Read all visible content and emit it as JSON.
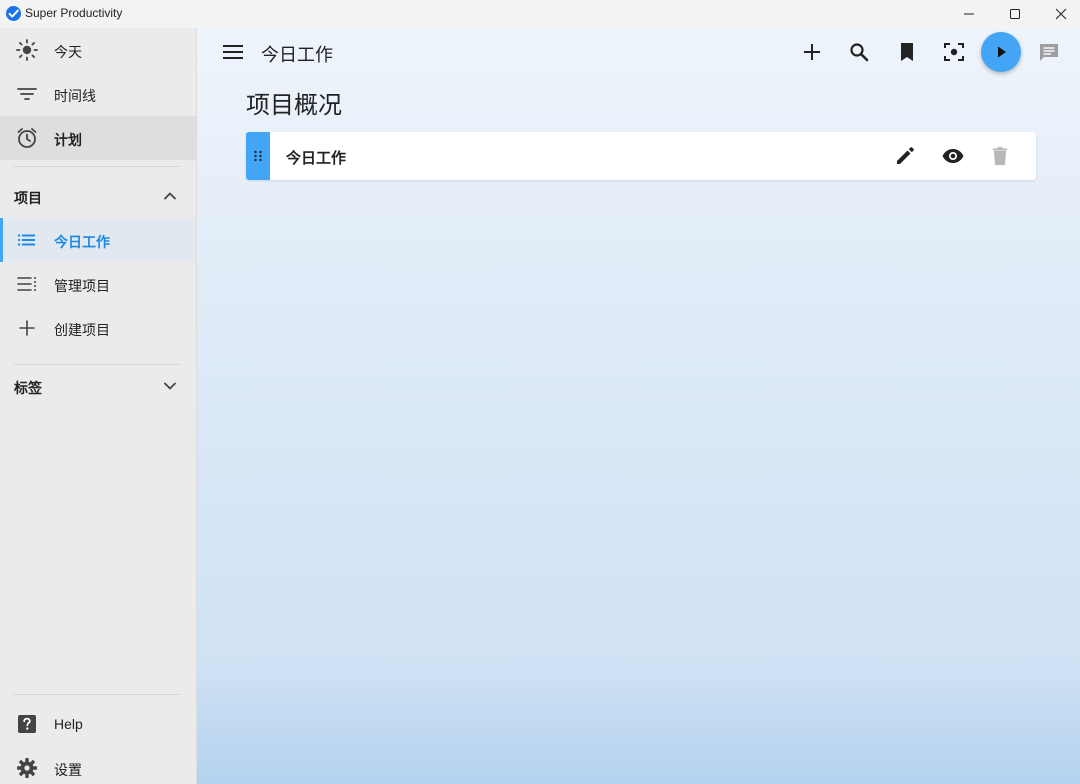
{
  "window": {
    "title": "Super Productivity"
  },
  "sidebar": {
    "nav": [
      {
        "label": "今天",
        "icon": "sun-icon"
      },
      {
        "label": "时间线",
        "icon": "filter-lines-icon"
      },
      {
        "label": "计划",
        "icon": "alarm-clock-icon"
      }
    ],
    "projects_section": {
      "label": "项目",
      "expanded": true
    },
    "projects": [
      {
        "label": "今日工作",
        "icon": "list-icon"
      },
      {
        "label": "管理项目",
        "icon": "manage-list-icon"
      },
      {
        "label": "创建项目",
        "icon": "plus-icon"
      }
    ],
    "tags_section": {
      "label": "标签",
      "expanded": false
    },
    "footer": [
      {
        "label": "Help",
        "icon": "help-icon"
      },
      {
        "label": "设置",
        "icon": "gear-icon"
      }
    ]
  },
  "header": {
    "title": "今日工作",
    "actions": [
      "add-icon",
      "search-icon",
      "bookmark-icon",
      "focus-icon",
      "play-icon",
      "comment-icon"
    ]
  },
  "main": {
    "page_title": "项目概况",
    "projects": [
      {
        "name": "今日工作"
      }
    ]
  },
  "colors": {
    "accent": "#42a5f5",
    "active_text": "#1e88e5"
  }
}
